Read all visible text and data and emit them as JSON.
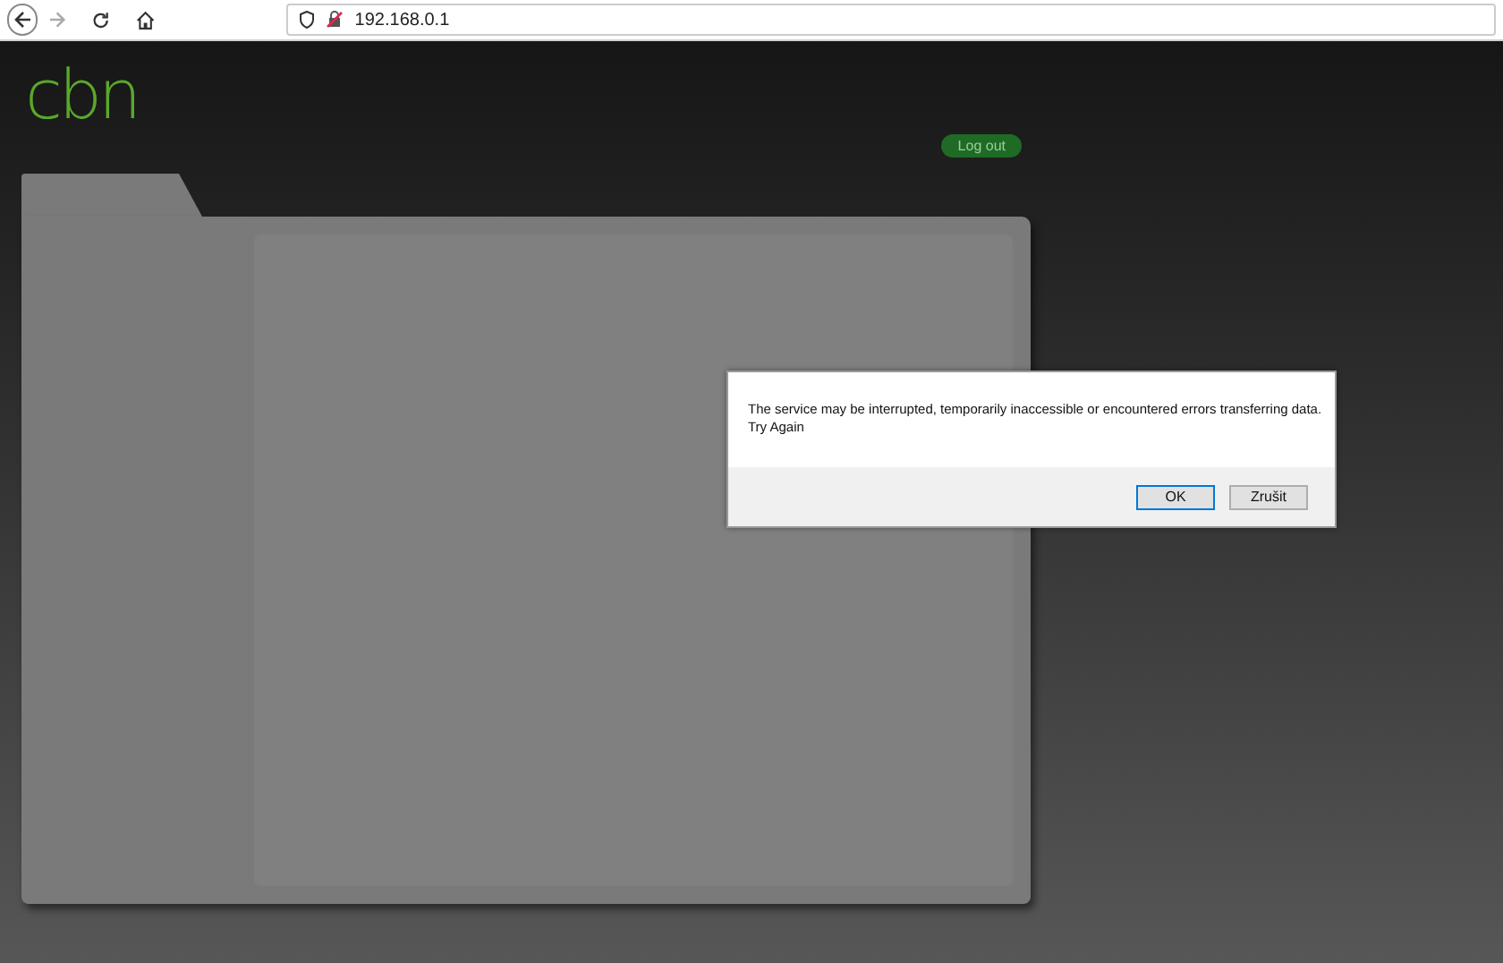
{
  "browser": {
    "address": "192.168.0.1",
    "back_enabled": true,
    "forward_enabled": false
  },
  "logo": {
    "text": "cbn"
  },
  "logout_button": {
    "label": "Log out"
  },
  "dialog": {
    "message": "The service may be interrupted, temporarily inaccessible or encountered errors transferring data.",
    "retry": "Try Again",
    "buttons": [
      {
        "label": "OK",
        "default": true
      },
      {
        "label": "Zrušit",
        "default": false
      }
    ]
  }
}
